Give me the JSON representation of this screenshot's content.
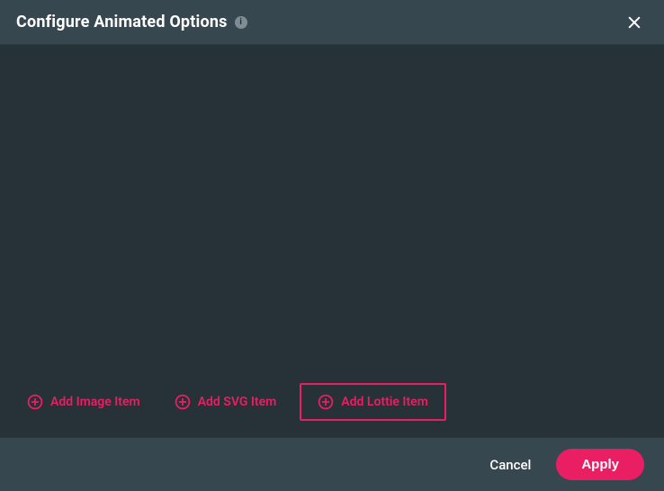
{
  "header": {
    "title": "Configure Animated Options",
    "info_tooltip": "i",
    "close_label": "Close"
  },
  "add_items": [
    {
      "label": "Add Image Item",
      "highlighted": false
    },
    {
      "label": "Add SVG Item",
      "highlighted": false
    },
    {
      "label": "Add Lottie Item",
      "highlighted": true
    }
  ],
  "footer": {
    "cancel_label": "Cancel",
    "apply_label": "Apply"
  },
  "colors": {
    "accent": "#E91E63",
    "panel_dark": "#263238",
    "panel_mid": "#37474F"
  }
}
